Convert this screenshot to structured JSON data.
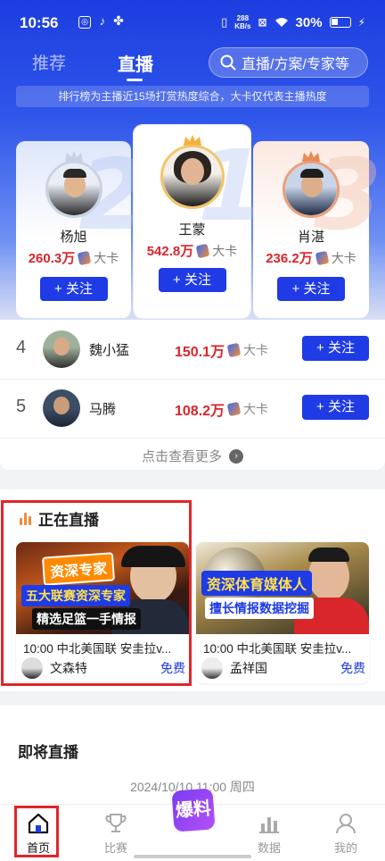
{
  "status": {
    "time": "10:56",
    "net_speed_value": "288",
    "net_speed_unit": "KB/s",
    "battery": "30%"
  },
  "tabs": [
    {
      "label": "推荐",
      "active": false
    },
    {
      "label": "直播",
      "active": true
    }
  ],
  "search": {
    "placeholder": "直播/方案/专家等"
  },
  "notice": "排行榜为主播近15场打赏热度综合，大卡仅代表主播热度",
  "podium": [
    {
      "rank": "2",
      "name": "杨旭",
      "heat": "260.3万",
      "unit": "大卡",
      "follow": "+ 关注",
      "crown_color": "#c9d3e6"
    },
    {
      "rank": "1",
      "name": "王蒙",
      "heat": "542.8万",
      "unit": "大卡",
      "follow": "+ 关注",
      "crown_color": "#f2b13e"
    },
    {
      "rank": "3",
      "name": "肖湛",
      "heat": "236.2万",
      "unit": "大卡",
      "follow": "+ 关注",
      "crown_color": "#e88a57"
    }
  ],
  "ranking": [
    {
      "rank": "4",
      "name": "魏小猛",
      "heat": "150.1万",
      "unit": "大卡",
      "follow": "+ 关注"
    },
    {
      "rank": "5",
      "name": "马腾",
      "heat": "108.2万",
      "unit": "大卡",
      "follow": "+ 关注"
    }
  ],
  "more_label": "点击查看更多",
  "live": {
    "title": "正在直播",
    "cards": [
      {
        "tag": "资深专家",
        "line1": "五大联赛资深专家",
        "line2": "精选足篮一手情报",
        "title": "10:00 中北美国联 安圭拉v...",
        "host": "文森特",
        "price": "免费"
      },
      {
        "tag": "资深体育媒体人",
        "line1": "擅长情报数据挖掘",
        "title": "10:00 中北美国联 安圭拉v...",
        "host": "孟祥国",
        "price": "免费"
      }
    ]
  },
  "upcoming": {
    "title": "即将直播",
    "date": "2024/10/10 11:00 周四"
  },
  "nav": [
    {
      "label": "首页",
      "active": true
    },
    {
      "label": "比赛",
      "active": false
    },
    {
      "label": "数据",
      "active": false
    },
    {
      "label": "我的",
      "active": false
    }
  ],
  "center_button": "爆料",
  "colors": {
    "brand": "#1f3be6",
    "heat": "#d9252c",
    "highlight_box": "#e0262b"
  }
}
